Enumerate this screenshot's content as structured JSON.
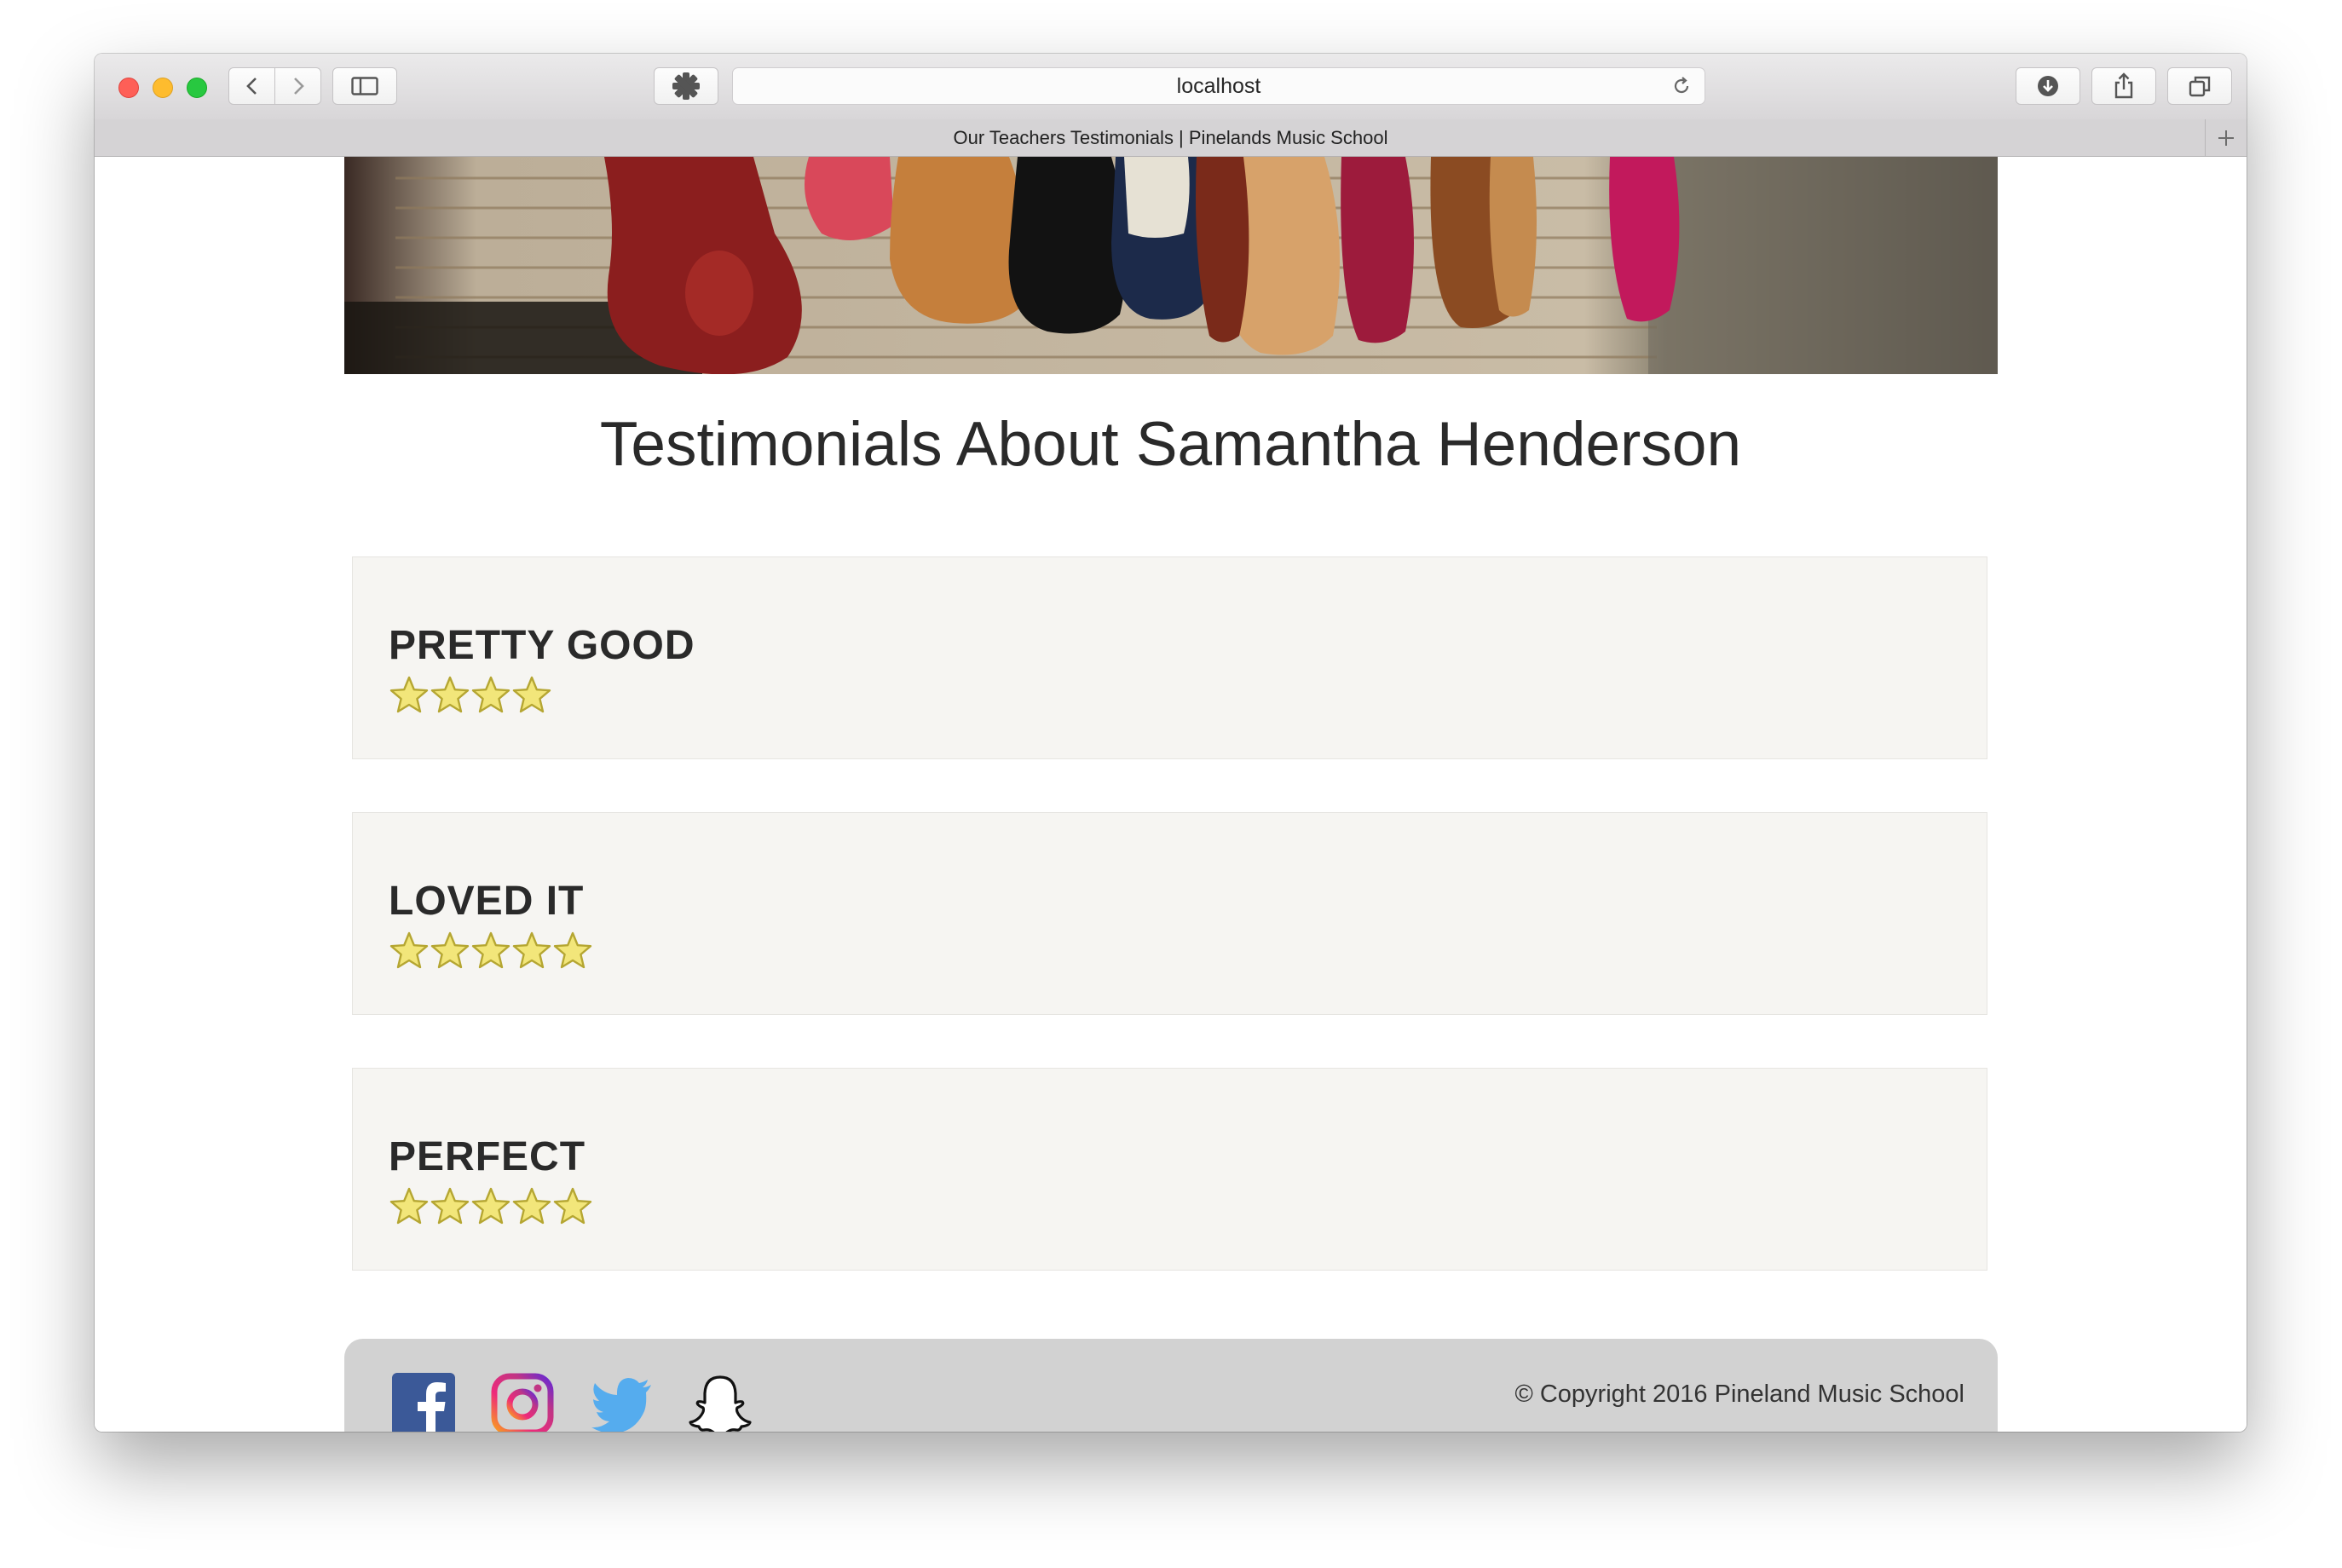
{
  "browser": {
    "url": "localhost",
    "tab_title": "Our Teachers Testimonials | Pinelands Music School"
  },
  "page": {
    "title": "Testimonials About Samantha Henderson",
    "testimonials": [
      {
        "title": "PRETTY GOOD",
        "rating": 4
      },
      {
        "title": "LOVED IT",
        "rating": 5
      },
      {
        "title": "PERFECT",
        "rating": 5
      }
    ],
    "footer": {
      "social": [
        "facebook-icon",
        "instagram-icon",
        "twitter-icon",
        "snapchat-icon"
      ],
      "copyright": "© Copyright 2016 Pineland Music School"
    }
  },
  "colors": {
    "star_fill": "#f2e67a",
    "star_stroke": "#b5a632",
    "facebook": "#3b5998",
    "twitter": "#55acee",
    "card_bg": "#f6f5f2",
    "footer_bg": "#d2d2d2"
  }
}
